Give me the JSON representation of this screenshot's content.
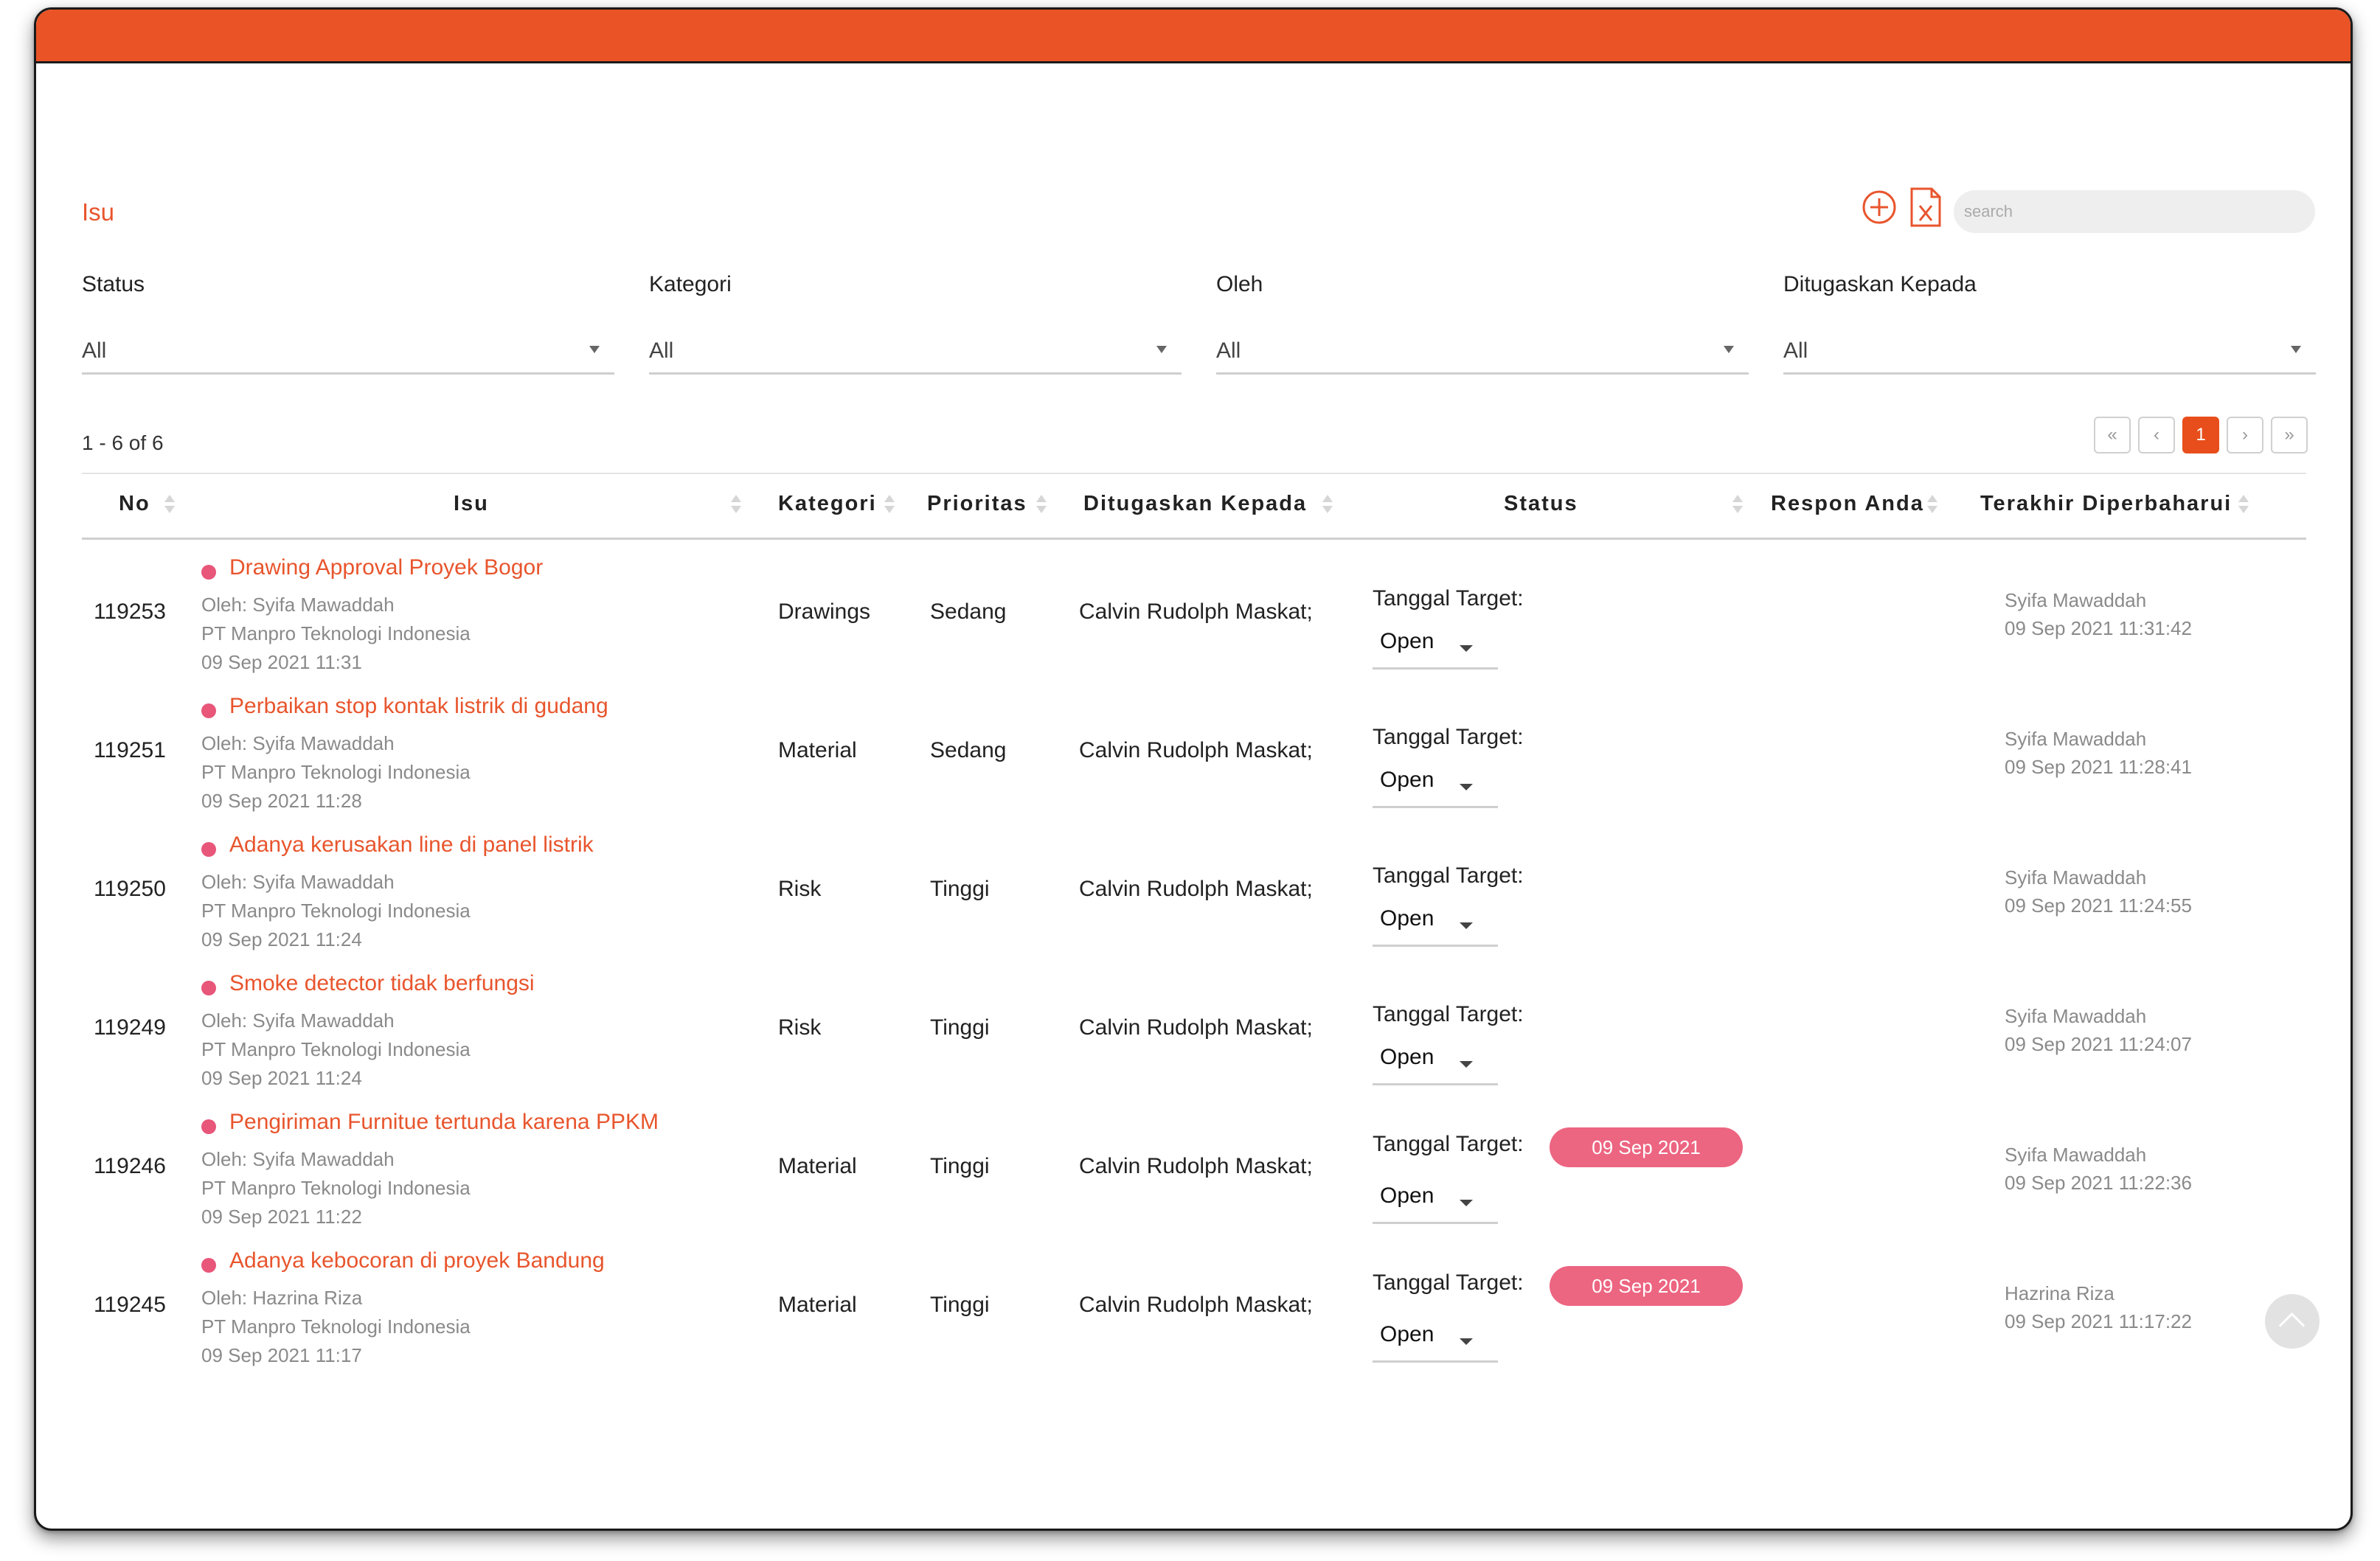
{
  "page": {
    "title": "Isu"
  },
  "toolbar": {
    "add_icon": "plus-circle-icon",
    "export_icon": "excel-file-icon",
    "search_placeholder": "search"
  },
  "colors": {
    "accent": "#ea5325",
    "issue_dot": "#e8567a",
    "badge": "#ec6581"
  },
  "filters": [
    {
      "label": "Status",
      "value": "All"
    },
    {
      "label": "Kategori",
      "value": "All"
    },
    {
      "label": "Oleh",
      "value": "All"
    },
    {
      "label": "Ditugaskan Kepada",
      "value": "All"
    }
  ],
  "range_text": "1 - 6 of 6",
  "pagination": {
    "first": "«",
    "prev": "‹",
    "current": "1",
    "next": "›",
    "last": "»"
  },
  "columns": [
    "No",
    "Isu",
    "Kategori",
    "Prioritas",
    "Ditugaskan Kepada",
    "Status",
    "Respon Anda",
    "Terakhir Diperbaharui"
  ],
  "rows": [
    {
      "no": "119253",
      "title": "Drawing Approval Proyek Bogor",
      "by": "Oleh: Syifa Mawaddah",
      "company": "PT Manpro Teknologi Indonesia",
      "date": "09 Sep 2021 11:31",
      "kategori": "Drawings",
      "prioritas": "Sedang",
      "assigned": "Calvin Rudolph Maskat;",
      "target_label": "Tanggal Target:",
      "target_date": "",
      "status": "Open",
      "updated_by": "Syifa Mawaddah",
      "updated_at": "09 Sep 2021 11:31:42"
    },
    {
      "no": "119251",
      "title": "Perbaikan stop kontak listrik di gudang",
      "by": "Oleh: Syifa Mawaddah",
      "company": "PT Manpro Teknologi Indonesia",
      "date": "09 Sep 2021 11:28",
      "kategori": "Material",
      "prioritas": "Sedang",
      "assigned": "Calvin Rudolph Maskat;",
      "target_label": "Tanggal Target:",
      "target_date": "",
      "status": "Open",
      "updated_by": "Syifa Mawaddah",
      "updated_at": "09 Sep 2021 11:28:41"
    },
    {
      "no": "119250",
      "title": "Adanya kerusakan line di panel listrik",
      "by": "Oleh: Syifa Mawaddah",
      "company": "PT Manpro Teknologi Indonesia",
      "date": "09 Sep 2021 11:24",
      "kategori": "Risk",
      "prioritas": "Tinggi",
      "assigned": "Calvin Rudolph Maskat;",
      "target_label": "Tanggal Target:",
      "target_date": "",
      "status": "Open",
      "updated_by": "Syifa Mawaddah",
      "updated_at": "09 Sep 2021 11:24:55"
    },
    {
      "no": "119249",
      "title": "Smoke detector tidak berfungsi",
      "by": "Oleh: Syifa Mawaddah",
      "company": "PT Manpro Teknologi Indonesia",
      "date": "09 Sep 2021 11:24",
      "kategori": "Risk",
      "prioritas": "Tinggi",
      "assigned": "Calvin Rudolph Maskat;",
      "target_label": "Tanggal Target:",
      "target_date": "",
      "status": "Open",
      "updated_by": "Syifa Mawaddah",
      "updated_at": "09 Sep 2021 11:24:07"
    },
    {
      "no": "119246",
      "title": "Pengiriman Furnitue tertunda karena PPKM",
      "by": "Oleh: Syifa Mawaddah",
      "company": "PT Manpro Teknologi Indonesia",
      "date": "09 Sep 2021 11:22",
      "kategori": "Material",
      "prioritas": "Tinggi",
      "assigned": "Calvin Rudolph Maskat;",
      "target_label": "Tanggal Target:",
      "target_date": "09 Sep 2021",
      "status": "Open",
      "updated_by": "Syifa Mawaddah",
      "updated_at": "09 Sep 2021 11:22:36"
    },
    {
      "no": "119245",
      "title": "Adanya kebocoran di proyek Bandung",
      "by": "Oleh: Hazrina Riza",
      "company": "PT Manpro Teknologi Indonesia",
      "date": "09 Sep 2021 11:17",
      "kategori": "Material",
      "prioritas": "Tinggi",
      "assigned": "Calvin Rudolph Maskat;",
      "target_label": "Tanggal Target:",
      "target_date": "09 Sep 2021",
      "status": "Open",
      "updated_by": "Hazrina Riza",
      "updated_at": "09 Sep 2021 11:17:22"
    }
  ]
}
